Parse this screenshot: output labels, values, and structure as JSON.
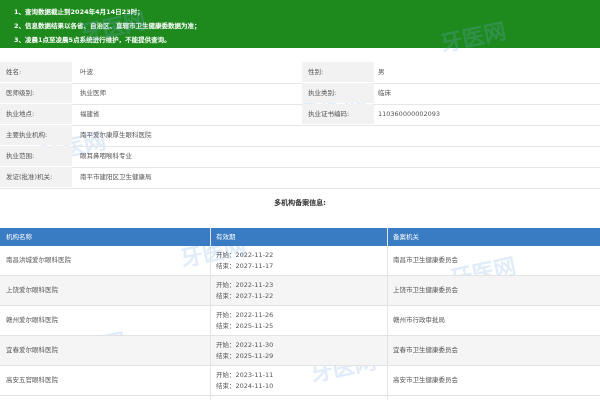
{
  "notice": {
    "lines": [
      "1、查询数据截止到2024年4月14日23时；",
      "2、信息数据结果以各省、自治区、直辖市卫生健康委数据为准；",
      "3、凌晨1点至凌晨5点系统进行维护，不能提供查询。"
    ],
    "bg_color": "#1e8a1e"
  },
  "watermark": "牙医网",
  "doctor": {
    "name_label": "姓名:",
    "name": "叶波",
    "gender_label": "性别:",
    "gender": "男",
    "level_label": "医师级别:",
    "level": "执业医师",
    "category_label": "执业类别:",
    "category": "临床",
    "location_label": "执业地点:",
    "location": "福建省",
    "cert_label": "执业证书编码:",
    "cert": "110360000002093",
    "org_label": "主要执业机构:",
    "org": "南平爱尔康厚生眼科医院",
    "scope_label": "执业范围:",
    "scope": "眼耳鼻咽喉科专业",
    "issuer_label": "发证(批准)机关:",
    "issuer": "南平市建阳区卫生健康局"
  },
  "records": {
    "title": "多机构备案信息:",
    "headers": [
      "机构名称",
      "有效期",
      "备案机关"
    ],
    "header_color": "#3a7cc4",
    "rows": [
      {
        "org": "南昌洪城爱尔眼科医院",
        "start": "开始：2022-11-22",
        "end": "结束：2027-11-17",
        "authority": "南昌市卫生健康委员会"
      },
      {
        "org": "上饶爱尔眼科医院",
        "start": "开始：2022-11-23",
        "end": "结束：2027-11-22",
        "authority": "上饶市卫生健康委员会"
      },
      {
        "org": "赣州爱尔眼科医院",
        "start": "开始：2022-11-26",
        "end": "结束：2025-11-25",
        "authority": "赣州市行政审批局"
      },
      {
        "org": "宜春爱尔眼科医院",
        "start": "开始：2022-11-30",
        "end": "结束：2025-11-29",
        "authority": "宜春市卫生健康委员会"
      },
      {
        "org": "高安五官眼科医院",
        "start": "开始：2023-11-11",
        "end": "结束：2024-11-10",
        "authority": "高安市卫生健康委员会"
      }
    ]
  }
}
